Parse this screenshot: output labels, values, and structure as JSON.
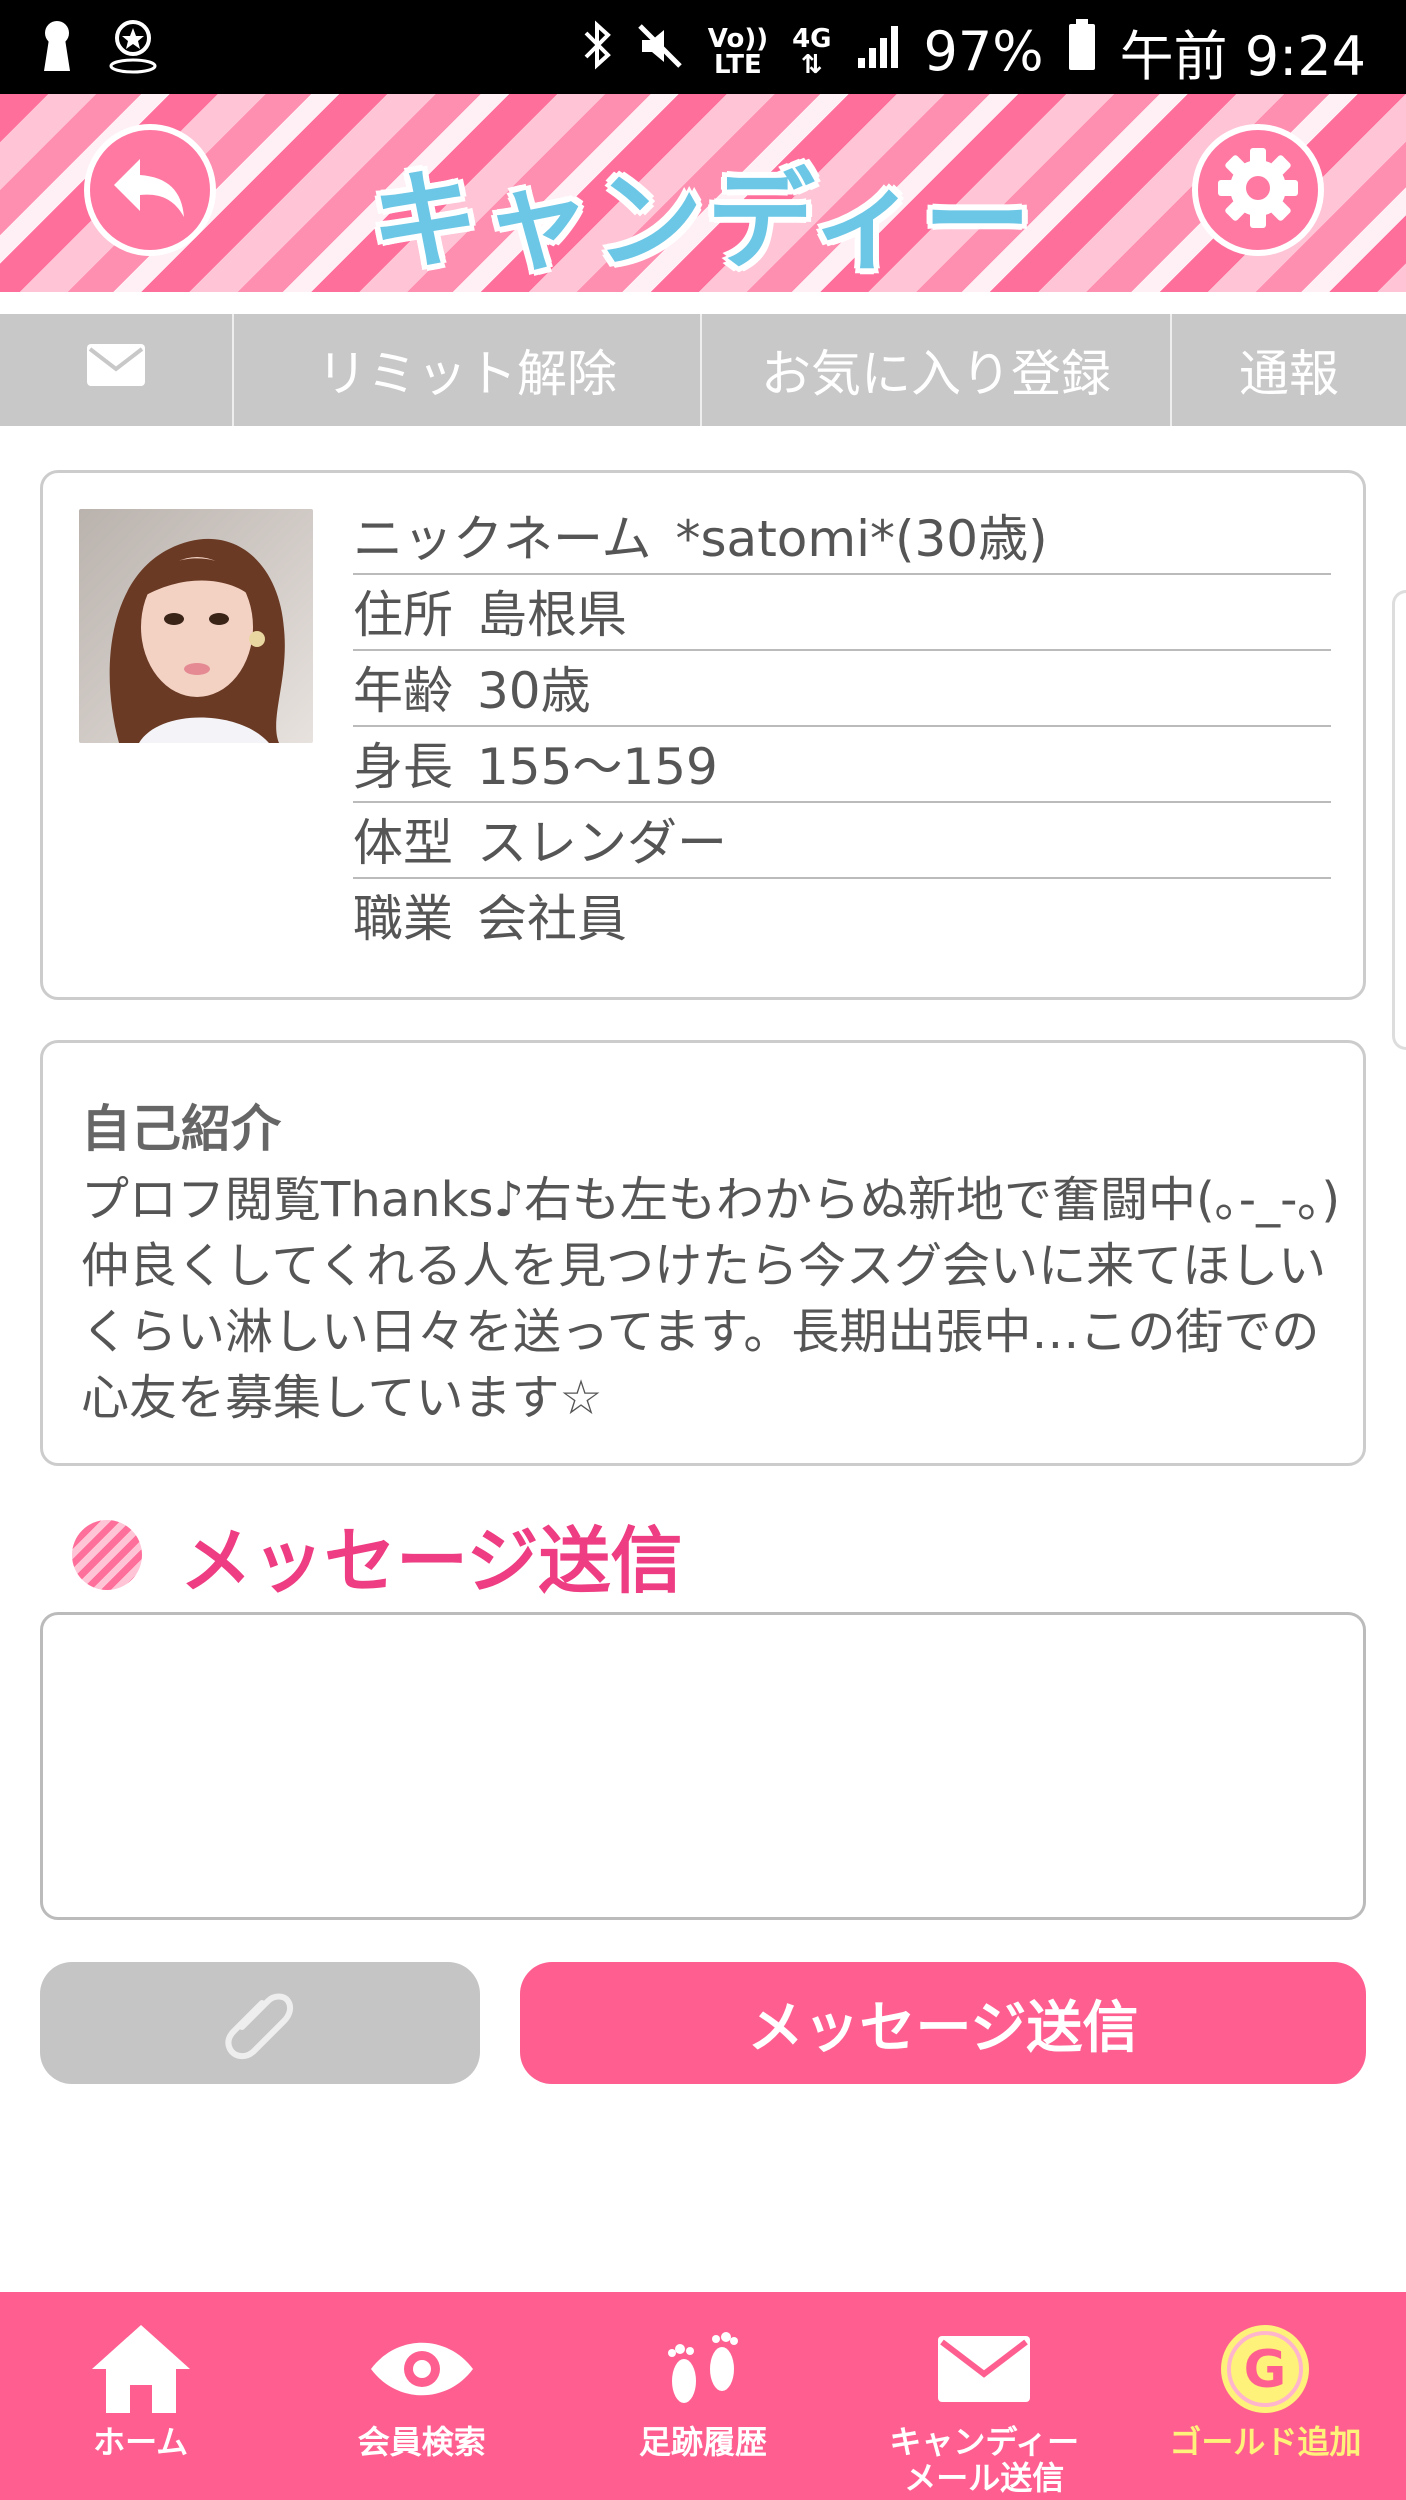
{
  "status_bar": {
    "volte_line1": "Vo))",
    "volte_line2": "LTE",
    "network": "4G",
    "battery": "97%",
    "time": "午前 9:24"
  },
  "header": {
    "title": "キャンディー",
    "back_icon": "back-arrow-icon",
    "settings_icon": "gear-icon"
  },
  "action_bar": {
    "mail_icon": "mail-icon",
    "limit_release": "リミット解除",
    "favorite_register": "お気に入り登録",
    "report": "通報"
  },
  "profile": {
    "rows": [
      {
        "label": "ニックネーム",
        "value": "*satomi*(30歳)"
      },
      {
        "label": "住所",
        "value": "島根県"
      },
      {
        "label": "年齢",
        "value": "30歳"
      },
      {
        "label": "身長",
        "value": "155〜159"
      },
      {
        "label": "体型",
        "value": "スレンダー"
      },
      {
        "label": "職業",
        "value": "会社員"
      }
    ]
  },
  "intro": {
    "title": "自己紹介",
    "body": "プロフ閲覧Thanks♪右も左もわからぬ新地で奮闘中(｡-_-｡)仲良くしてくれる人を見つけたら今スグ会いに来てほしいくらい淋しい日々を送ってます。長期出張中…この街での心友を募集しています☆"
  },
  "message": {
    "heading": "メッセージ送信",
    "input_value": "",
    "attach_icon": "paperclip-icon",
    "send_label": "メッセージ送信"
  },
  "bottom_nav": {
    "items": [
      {
        "label": "ホーム",
        "icon": "home-icon"
      },
      {
        "label": "会員検索",
        "icon": "eye-icon"
      },
      {
        "label": "足跡履歴",
        "icon": "footprints-icon"
      },
      {
        "label": "キャンディー\nメール送信",
        "icon": "mail-icon"
      },
      {
        "label": "ゴールド追加",
        "icon": "gold-coin-icon"
      }
    ],
    "gold_letter": "G"
  },
  "colors": {
    "accent_pink": "#ff5f90",
    "heading_pink": "#ee3d82",
    "logo_blue": "#6cc7e6",
    "gray_bar": "#c8c8c8",
    "gold": "#fff27a"
  }
}
